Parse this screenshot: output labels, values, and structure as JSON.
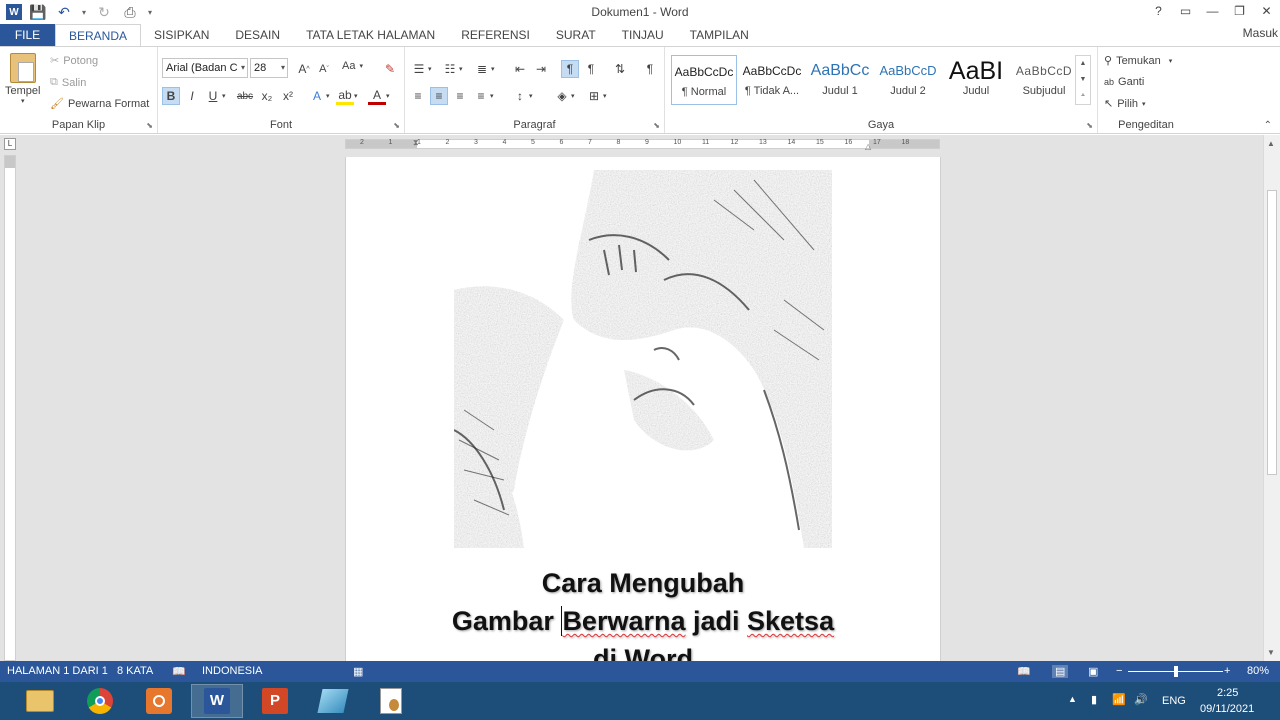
{
  "window": {
    "title": "Dokumen1 - Word",
    "controls": [
      "?",
      "▭",
      "—",
      "❐",
      "✕"
    ]
  },
  "tabs": [
    "FILE",
    "BERANDA",
    "SISIPKAN",
    "DESAIN",
    "TATA LETAK HALAMAN",
    "REFERENSI",
    "SURAT",
    "TINJAU",
    "TAMPILAN"
  ],
  "active_tab": "BERANDA",
  "signin": "Masuk",
  "clipboard": {
    "paste": "Tempel",
    "cut": "Potong",
    "copy": "Salin",
    "format_painter": "Pewarna Format",
    "label": "Papan Klip"
  },
  "font": {
    "name": "Arial (Badan C",
    "size": "28",
    "label": "Font",
    "case": "Aa",
    "bold": "B",
    "italic": "I",
    "underline": "U",
    "strike": "abc",
    "sub": "x₂",
    "sup": "x²"
  },
  "paragraph": {
    "label": "Paragraf"
  },
  "styles": {
    "label": "Gaya",
    "items": [
      {
        "preview": "AaBbCcDc",
        "name": "¶ Normal"
      },
      {
        "preview": "AaBbCcDc",
        "name": "¶ Tidak A..."
      },
      {
        "preview": "AaBbCc",
        "name": "Judul 1"
      },
      {
        "preview": "AaBbCcD",
        "name": "Judul 2"
      },
      {
        "preview": "AaBI",
        "name": "Judul"
      },
      {
        "preview": "AaBbCcD",
        "name": "Subjudul"
      }
    ]
  },
  "editing": {
    "label": "Pengeditan",
    "find": "Temukan",
    "replace": "Ganti",
    "select": "Pilih"
  },
  "ruler_numbers": [
    "2",
    "1",
    "1",
    "2",
    "3",
    "4",
    "5",
    "6",
    "7",
    "8",
    "9",
    "10",
    "11",
    "12",
    "13",
    "14",
    "15",
    "16",
    "17",
    "18"
  ],
  "document": {
    "title_line1": "Cara Mengubah",
    "title_line2a": "Gambar ",
    "title_line2b": "Berwarna",
    "title_line2c": " jadi ",
    "title_line2d": "Sketsa",
    "title_line3": "di Word"
  },
  "status": {
    "page": "HALAMAN 1 DARI 1",
    "words": "8 KATA",
    "language": "INDONESIA",
    "zoom": "80%",
    "zoom_fraction": 0.5
  },
  "taskbar": {
    "apps": [
      "file-explorer",
      "chrome",
      "recorder",
      "word",
      "powerpoint",
      "app",
      "notepad"
    ],
    "lang": "ENG",
    "time": "2:25",
    "date": "09/11/2021"
  },
  "colors": {
    "accent": "#2b579a",
    "taskbar": "#1d4e7a"
  }
}
